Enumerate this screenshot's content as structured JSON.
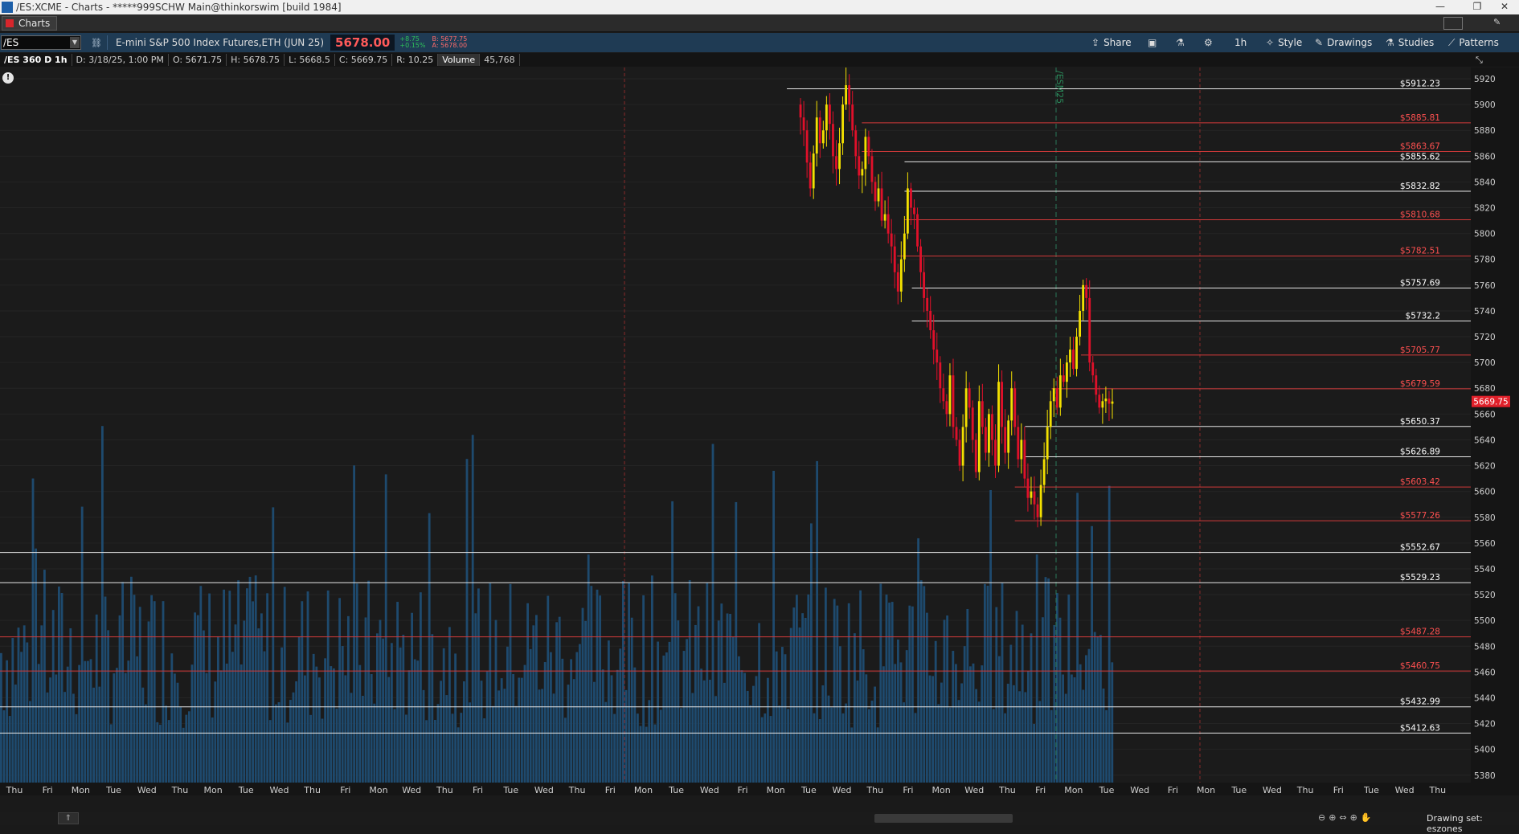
{
  "window": {
    "title": "/ES:XCME - Charts - *****999SCHW Main@thinkorswim [build 1984]",
    "minimize": "—",
    "restore": "❐",
    "close": "✕"
  },
  "menubar": {
    "tab_label": "Charts"
  },
  "toolbar": {
    "symbol": "/ES",
    "description": "E-mini S&P 500 Index Futures,ETH (JUN 25)",
    "last": "5678.00",
    "change": "+8.75",
    "change_pct": "+0.15%",
    "bid": "B: 5677.75",
    "ask": "A: 5678.00",
    "share": "Share",
    "timeframe": "1h",
    "style": "Style",
    "drawings": "Drawings",
    "studies": "Studies",
    "patterns": "Patterns"
  },
  "infobar": {
    "title": "/ES 360 D 1h",
    "date": "D: 3/18/25, 1:00 PM",
    "open": "O: 5671.75",
    "high": "H: 5678.75",
    "low": "L: 5668.5",
    "close": "C: 5669.75",
    "range": "R: 10.25",
    "volume_label": "Volume",
    "volume_value": "45,768"
  },
  "status": {
    "drawing_set": "Drawing set: eszones"
  },
  "chart_data": {
    "type": "candlestick",
    "current_price": 5669.75,
    "current_price_label": "5669.75",
    "y_ticks": [
      5380,
      5400,
      5420,
      5440,
      5460,
      5480,
      5500,
      5520,
      5540,
      5560,
      5580,
      5600,
      5620,
      5640,
      5660,
      5680,
      5700,
      5720,
      5740,
      5760,
      5780,
      5800,
      5820,
      5840,
      5860,
      5880,
      5900,
      5920
    ],
    "ylim": [
      5373,
      5925
    ],
    "x_ticks": [
      "Thu",
      "Fri",
      "Mon",
      "Tue",
      "Wed",
      "Thu",
      "Mon",
      "Tue",
      "Wed",
      "Thu",
      "Fri",
      "Mon",
      "Wed",
      "Thu",
      "Fri",
      "Tue",
      "Wed",
      "Thu",
      "Fri",
      "Mon",
      "Tue",
      "Wed",
      "Fri",
      "Mon",
      "Tue",
      "Wed",
      "Thu",
      "Fri",
      "Mon",
      "Wed",
      "Thu",
      "Fri",
      "Mon",
      "Tue",
      "Wed",
      "Fri",
      "Mon",
      "Tue",
      "Wed",
      "Thu",
      "Fri",
      "Tue",
      "Wed",
      "Thu"
    ],
    "expiry_label": "/ESM25",
    "levels": [
      {
        "label": "$5912.23",
        "value": 5912.23,
        "color": "white",
        "start_frac": 0.535
      },
      {
        "label": "$5885.81",
        "value": 5885.81,
        "color": "red",
        "start_frac": 0.586
      },
      {
        "label": "$5863.67",
        "value": 5863.67,
        "color": "red",
        "start_frac": 0.586
      },
      {
        "label": "$5855.62",
        "value": 5855.62,
        "color": "white",
        "start_frac": 0.615
      },
      {
        "label": "$5832.82",
        "value": 5832.82,
        "color": "white",
        "start_frac": 0.615
      },
      {
        "label": "$5810.68",
        "value": 5810.68,
        "color": "red",
        "start_frac": 0.615
      },
      {
        "label": "$5782.51",
        "value": 5782.51,
        "color": "red",
        "start_frac": 0.61
      },
      {
        "label": "$5757.69",
        "value": 5757.69,
        "color": "white",
        "start_frac": 0.62
      },
      {
        "label": "$5732.2",
        "value": 5732.2,
        "color": "white",
        "start_frac": 0.62
      },
      {
        "label": "$5705.77",
        "value": 5705.77,
        "color": "red",
        "start_frac": 0.735
      },
      {
        "label": "$5679.59",
        "value": 5679.59,
        "color": "red",
        "start_frac": 0.715
      },
      {
        "label": "$5650.37",
        "value": 5650.37,
        "color": "white",
        "start_frac": 0.697
      },
      {
        "label": "$5626.89",
        "value": 5626.89,
        "color": "white",
        "start_frac": 0.697
      },
      {
        "label": "$5603.42",
        "value": 5603.42,
        "color": "red",
        "start_frac": 0.69
      },
      {
        "label": "$5577.26",
        "value": 5577.26,
        "color": "red",
        "start_frac": 0.69
      },
      {
        "label": "$5552.67",
        "value": 5552.67,
        "color": "white",
        "start_frac": 0.0
      },
      {
        "label": "$5529.23",
        "value": 5529.23,
        "color": "white",
        "start_frac": 0.0
      },
      {
        "label": "$5487.28",
        "value": 5487.28,
        "color": "red",
        "start_frac": 0.0
      },
      {
        "label": "$5460.75",
        "value": 5460.75,
        "color": "red",
        "start_frac": 0.0
      },
      {
        "label": "$5432.99",
        "value": 5432.99,
        "color": "white",
        "start_frac": 0.0
      },
      {
        "label": "$5412.63",
        "value": 5412.63,
        "color": "white",
        "start_frac": 0.0
      }
    ],
    "candle_path": [
      5900,
      5890,
      5880,
      5855,
      5835,
      5862,
      5890,
      5870,
      5880,
      5900,
      5885,
      5860,
      5850,
      5870,
      5900,
      5915,
      5900,
      5880,
      5860,
      5845,
      5850,
      5875,
      5860,
      5840,
      5825,
      5835,
      5810,
      5815,
      5800,
      5790,
      5770,
      5755,
      5780,
      5800,
      5835,
      5820,
      5815,
      5790,
      5770,
      5750,
      5740,
      5725,
      5710,
      5700,
      5680,
      5670,
      5660,
      5690,
      5650,
      5640,
      5620,
      5650,
      5680,
      5665,
      5640,
      5615,
      5670,
      5650,
      5630,
      5660,
      5640,
      5620,
      5685,
      5650,
      5630,
      5655,
      5680,
      5650,
      5625,
      5640,
      5610,
      5595,
      5600,
      5590,
      5580,
      5605,
      5625,
      5650,
      5670,
      5680,
      5665,
      5690,
      5685,
      5700,
      5710,
      5695,
      5720,
      5740,
      5760,
      5750,
      5700,
      5690,
      5675,
      5665,
      5670,
      5672,
      5668,
      5669.75
    ]
  }
}
